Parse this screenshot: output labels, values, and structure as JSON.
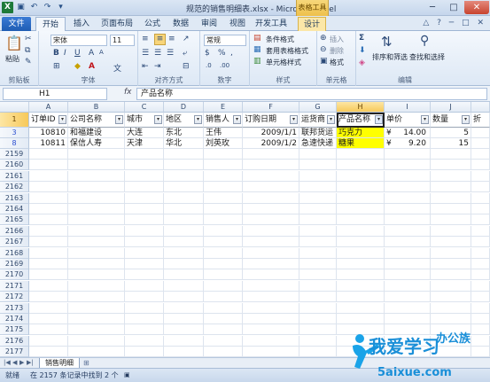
{
  "window": {
    "title": "规范的销售明细表.xlsx - Microsoft Excel",
    "context_tab": "表格工具"
  },
  "tabs": [
    "文件",
    "开始",
    "插入",
    "页面布局",
    "公式",
    "数据",
    "审阅",
    "视图",
    "开发工具",
    "设计"
  ],
  "ribbon": {
    "groups": {
      "clipboard": "剪贴板",
      "font": "字体",
      "alignment": "对齐方式",
      "number": "数字",
      "styles": "样式",
      "cells": "单元格",
      "editing": "编辑"
    },
    "paste_label": "粘贴",
    "font_name": "宋体",
    "font_size": "11",
    "number_format": "常规",
    "cond_format": "条件格式",
    "table_format": "套用表格格式",
    "cell_styles": "单元格样式",
    "insert": "插入",
    "delete": "删除",
    "format": "格式",
    "sort_filter": "排序和筛选",
    "find_select": "查找和选择"
  },
  "formula_bar": {
    "name_box": "H1",
    "fx": "fx",
    "content": "产品名称"
  },
  "columns": [
    "A",
    "B",
    "C",
    "D",
    "E",
    "F",
    "G",
    "H",
    "I",
    "J"
  ],
  "header_row": {
    "row_number": "1",
    "cells": [
      "订单ID",
      "公司名称",
      "城市",
      "地区",
      "销售人",
      "订购日期",
      "运货商",
      "产品名称",
      "单价",
      "数量"
    ]
  },
  "data_rows": [
    {
      "row_number": "3",
      "cells": [
        "10810",
        "和福建设",
        "大连",
        "东北",
        "王伟",
        "2009/1/1",
        "联邦货运",
        "巧克力",
        "¥",
        "14.00",
        "5"
      ]
    },
    {
      "row_number": "8",
      "cells": [
        "10811",
        "保信人寿",
        "天津",
        "华北",
        "刘英玫",
        "2009/1/2",
        "急速快递",
        "糖果",
        "¥",
        "9.20",
        "15"
      ]
    }
  ],
  "empty_rows": [
    "2159",
    "2160",
    "2161",
    "2162",
    "2163",
    "2164",
    "2165",
    "2166",
    "2167",
    "2168",
    "2169",
    "2170",
    "2171",
    "2172",
    "2173",
    "2174",
    "2175",
    "2176",
    "2177"
  ],
  "sheet_tab": "销售明细",
  "status": {
    "ready": "就绪",
    "found": "在 2157 条记录中找到 2 个"
  },
  "watermark": {
    "text": "我爱学习",
    "site": "5aixue.com",
    "brand": "办公族"
  },
  "colors": {
    "highlight": "#ffff00",
    "selected_header": "#f7c95a",
    "filtered_row_number": "#2a4fd0"
  }
}
